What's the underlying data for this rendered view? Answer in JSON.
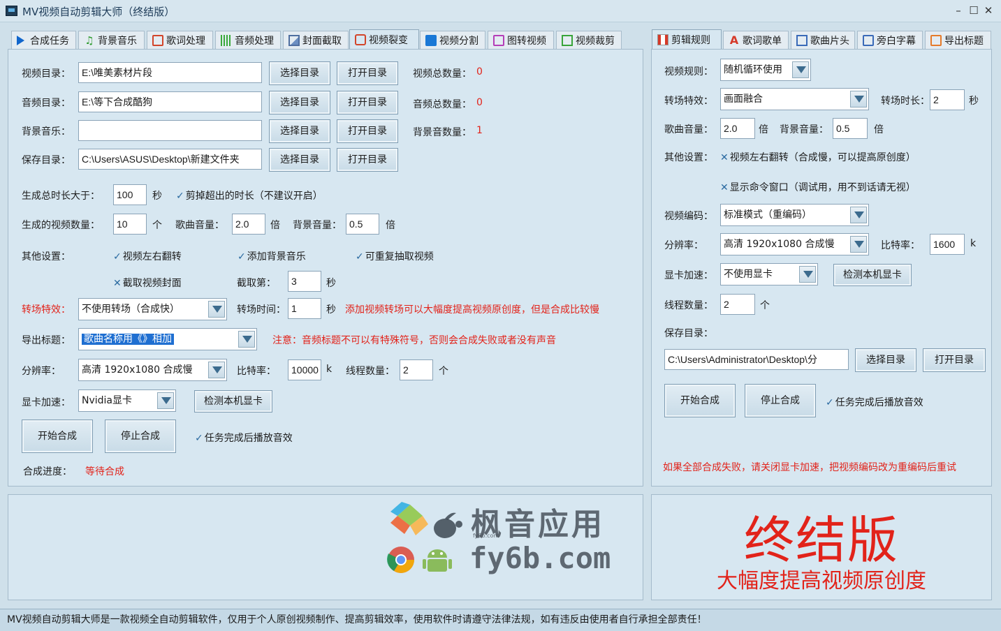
{
  "window": {
    "title": "MV视频自动剪辑大师（终结版）"
  },
  "left_tabs": [
    "合成任务",
    "背景音乐",
    "歌词处理",
    "音频处理",
    "封面截取",
    "视频裂变",
    "视频分割",
    "图转视频",
    "视频裁剪"
  ],
  "right_tabs": [
    "剪辑规则",
    "歌词歌单",
    "歌曲片头",
    "旁白字幕",
    "导出标题"
  ],
  "left": {
    "video_dir": {
      "label": "视频目录：",
      "value": "E:\\唯美素材片段"
    },
    "audio_dir": {
      "label": "音频目录：",
      "value": "E:\\等下合成酷狗"
    },
    "bgm_dir": {
      "label": "背景音乐：",
      "value": ""
    },
    "save_dir": {
      "label": "保存目录：",
      "value": "C:\\Users\\ASUS\\Desktop\\新建文件夹"
    },
    "choose_btn": "选择目录",
    "open_btn": "打开目录",
    "video_total": {
      "label": "视频总数量：",
      "value": "0"
    },
    "audio_total": {
      "label": "音频总数量：",
      "value": "0"
    },
    "bgm_total": {
      "label": "背景音数量：",
      "value": "1"
    },
    "duration": {
      "label": "生成总时长大于：",
      "value": "100",
      "unit": "秒"
    },
    "trim_check": "剪掉超出的时长（不建议开启）",
    "count": {
      "label": "生成的视频数量：",
      "value": "10",
      "unit": "个"
    },
    "song_vol": {
      "label": "歌曲音量：",
      "value": "2.0",
      "unit": "倍"
    },
    "bg_vol": {
      "label": "背景音量：",
      "value": "0.5",
      "unit": "倍"
    },
    "other_label": "其他设置：",
    "opt_flip": "视频左右翻转",
    "opt_bgm": "添加背景音乐",
    "opt_repeat": "可重复抽取视频",
    "opt_cover": "截取视频封面",
    "capture": {
      "label": "截取第：",
      "value": "3",
      "unit": "秒"
    },
    "transition": {
      "label": "转场特效：",
      "value": "不使用转场（合成快）"
    },
    "trans_time": {
      "label": "转场时间：",
      "value": "1",
      "unit": "秒"
    },
    "trans_note": "添加视频转场可以大幅度提高视频原创度，但是合成比较慢",
    "export_title": {
      "label": "导出标题：",
      "value": "歌曲名称用《》相加"
    },
    "export_note": "注意：音频标题不可以有特殊符号，否则会合成失败或者没有声音",
    "resolution": {
      "label": "分辨率：",
      "value": "高清 1920x1080 合成慢"
    },
    "bitrate": {
      "label": "比特率：",
      "value": "10000",
      "unit": "k"
    },
    "threads": {
      "label": "线程数量：",
      "value": "2",
      "unit": "个"
    },
    "gpu": {
      "label": "显卡加速：",
      "value": "Nvidia显卡"
    },
    "detect_btn": "检测本机显卡",
    "start_btn": "开始合成",
    "stop_btn": "停止合成",
    "sound_check": "任务完成后播放音效",
    "progress": {
      "label": "合成进度：",
      "value": "等待合成"
    }
  },
  "right": {
    "rule": {
      "label": "视频规则：",
      "value": "随机循环使用"
    },
    "transition": {
      "label": "转场特效：",
      "value": "画面融合"
    },
    "trans_len": {
      "label": "转场时长：",
      "value": "2",
      "unit": "秒"
    },
    "song_vol": {
      "label": "歌曲音量：",
      "value": "2.0",
      "unit": "倍"
    },
    "bg_vol": {
      "label": "背景音量：",
      "value": "0.5",
      "unit": "倍"
    },
    "other_label": "其他设置：",
    "opt_flip": "视频左右翻转（合成慢，可以提高原创度）",
    "opt_cmd": "显示命令窗口（调试用，用不到话请无视）",
    "encode": {
      "label": "视频编码：",
      "value": "标准模式（重编码）"
    },
    "resolution": {
      "label": "分辨率：",
      "value": "高清 1920x1080 合成慢"
    },
    "bitrate": {
      "label": "比特率：",
      "value": "1600",
      "unit": "k"
    },
    "gpu": {
      "label": "显卡加速：",
      "value": "不使用显卡"
    },
    "detect_btn": "检测本机显卡",
    "threads": {
      "label": "线程数量：",
      "value": "2",
      "unit": "个"
    },
    "save_label": "保存目录：",
    "save_value": "C:\\Users\\Administrator\\Desktop\\分",
    "choose_btn": "选择目录",
    "open_btn": "打开目录",
    "start_btn": "开始合成",
    "stop_btn": "停止合成",
    "sound_check": "任务完成后播放音效",
    "warning": "如果全部合成失败，请关闭显卡加速，把视频编码改为重编码后重试"
  },
  "watermark": {
    "cn": "枫音应用",
    "small": "fy6b.com",
    "en": "fy6b.com"
  },
  "banner": {
    "big": "终结版",
    "sub": "大幅度提高视频原创度"
  },
  "statusbar": "MV视频自动剪辑大师是一款视频全自动剪辑软件，仅用于个人原创视频制作、提高剪辑效率，使用软件时请遵守法律法规，如有违反由使用者自行承担全部责任！",
  "colors": {
    "accent_red": "#e2231a",
    "selection": "#1f6fd1",
    "panel_bg": "#d7e7f1"
  }
}
